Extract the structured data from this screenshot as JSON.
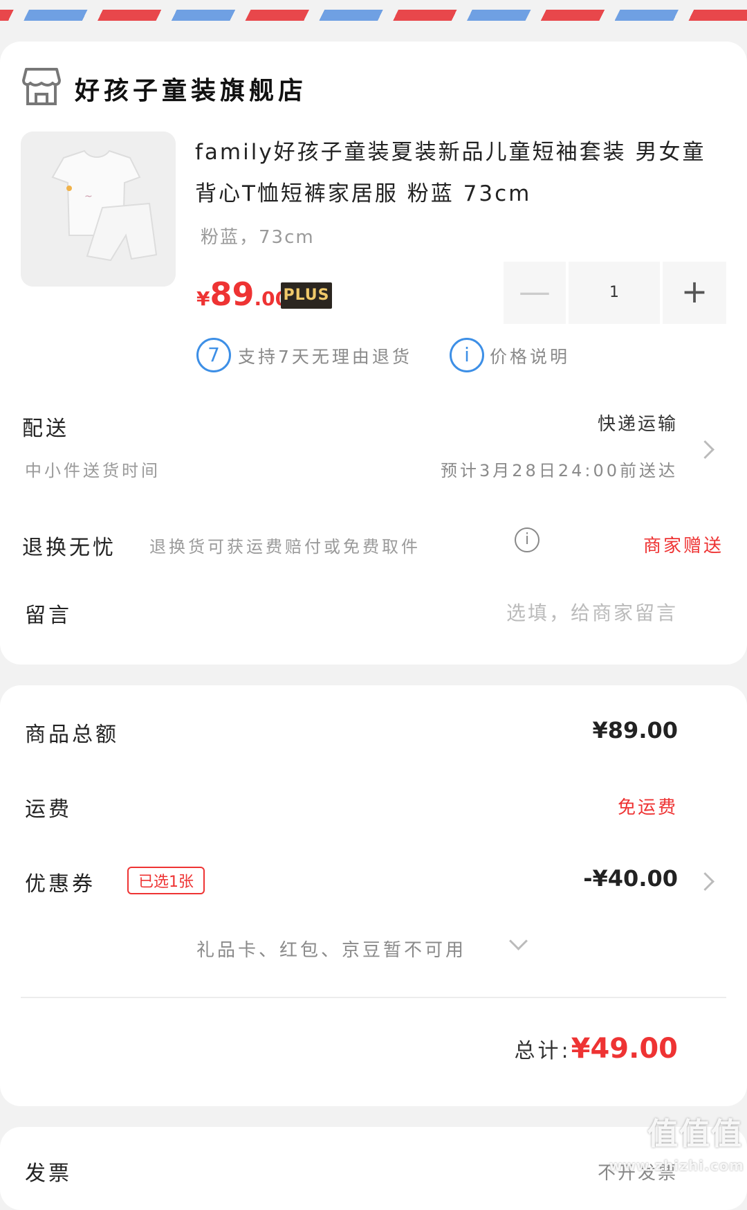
{
  "store": {
    "name": "好孩子童装旗舰店",
    "icon": "store-icon"
  },
  "product": {
    "title": "family好孩子童装夏装新品儿童短袖套装 男女童背心T恤短裤家居服 粉蓝 73cm",
    "spec": "粉蓝，73cm",
    "price_symbol": "¥",
    "price_int": "89",
    "price_dec": ".00",
    "plus_badge": "PLUS",
    "quantity": "1",
    "minus_symbol": "—",
    "plus_symbol": "+"
  },
  "services": [
    {
      "icon_text": "7",
      "icon": "seven-day-return-icon",
      "label": "支持7天无理由退货"
    },
    {
      "icon_text": "i",
      "icon": "info-icon",
      "label": "价格说明"
    }
  ],
  "delivery": {
    "label": "配送",
    "method": "快递运输",
    "sub_label": "中小件送货时间",
    "eta": "预计3月28日24:00前送达"
  },
  "return_service": {
    "label": "退换无忧",
    "desc": "退换货可获运费赔付或免费取件",
    "value": "商家赠送"
  },
  "message": {
    "label": "留言",
    "placeholder": "选填，给商家留言"
  },
  "summary": {
    "goods_label": "商品总额",
    "goods_value": "¥89.00",
    "shipping_label": "运费",
    "shipping_value": "免运费",
    "coupon_label": "优惠券",
    "coupon_badge": "已选1张",
    "coupon_value": "-¥40.00",
    "others_text": "礼品卡、红包、京豆暂不可用",
    "total_label": "总计:",
    "total_value": "¥49.00"
  },
  "invoice": {
    "label": "发票",
    "value": "不开发票"
  },
  "watermark": {
    "mark": "值值值",
    "site": "www.zhizhi.com"
  },
  "colors": {
    "accent_red": "#e33333",
    "info_blue": "#3d8fe6",
    "plus_gold": "#f0c96a"
  }
}
